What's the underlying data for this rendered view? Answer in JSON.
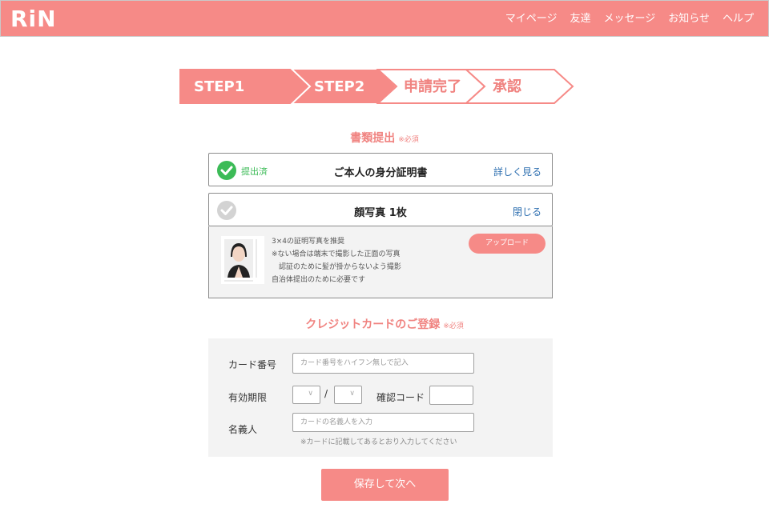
{
  "header": {
    "logo": "RiN",
    "nav": [
      "マイページ",
      "友達",
      "メッセージ",
      "お知らせ",
      "ヘルプ"
    ]
  },
  "steps": [
    {
      "label": "STEP1",
      "state": "active"
    },
    {
      "label": "STEP2",
      "state": "active"
    },
    {
      "label": "申請完了",
      "state": "inactive"
    },
    {
      "label": "承認",
      "state": "inactive"
    }
  ],
  "documents": {
    "title": "書類提出",
    "required": "※必須",
    "id_doc": {
      "status": "提出済",
      "title": "ご本人の身分証明書",
      "link": "詳しく見る"
    },
    "photo_doc": {
      "title": "顔写真 1枚",
      "link": "閉じる"
    },
    "photo_detail": {
      "lines": [
        "3×4の証明写真を推奨",
        "※ない場合は端末で撮影した正面の写真",
        "　認証のために髪が掛からないよう撮影",
        "自治体提出のために必要です"
      ],
      "upload_label": "アップロード"
    }
  },
  "card": {
    "title": "クレジットカードのご登録",
    "required": "※必須",
    "number_label": "カード番号",
    "number_placeholder": "カード番号をハイフン無しで記入",
    "expiry_label": "有効期限",
    "expiry_separator": "/",
    "cvc_label": "確認コード",
    "holder_label": "名義人",
    "holder_placeholder": "カードの名義人を入力",
    "note": "※カードに記載してあるとおり入力してください"
  },
  "save_label": "保存して次へ",
  "colors": {
    "brand": "#f68a87",
    "accent_text": "#f08380",
    "success": "#3cbb57",
    "link": "#2e6fb0"
  }
}
